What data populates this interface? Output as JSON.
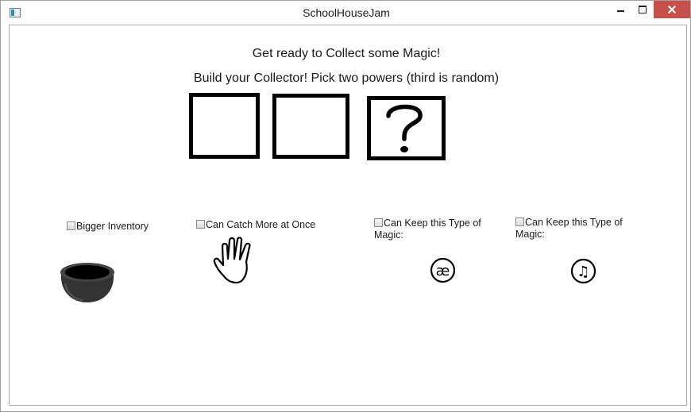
{
  "window": {
    "title": "SchoolHouseJam",
    "icon": "app-window-icon",
    "close_color": "#c7504a"
  },
  "content": {
    "line1": "Get ready to Collect some Magic!",
    "line2": "Build your Collector! Pick two powers (third is random)"
  },
  "slots": [
    {
      "state": "empty"
    },
    {
      "state": "empty"
    },
    {
      "state": "random",
      "icon": "question-mark-icon"
    }
  ],
  "powers": [
    {
      "label": "Bigger Inventory",
      "checked": false,
      "icon": "cauldron-icon"
    },
    {
      "label": "Can Catch More at Once",
      "checked": false,
      "icon": "hand-icon"
    },
    {
      "label": "Can Keep this Type of Magic:",
      "checked": false,
      "icon": "ae-ligature-icon",
      "glyph": "æ"
    },
    {
      "label": "Can Keep this Type of Magic:",
      "checked": false,
      "icon": "music-note-icon",
      "glyph": "♫"
    }
  ]
}
